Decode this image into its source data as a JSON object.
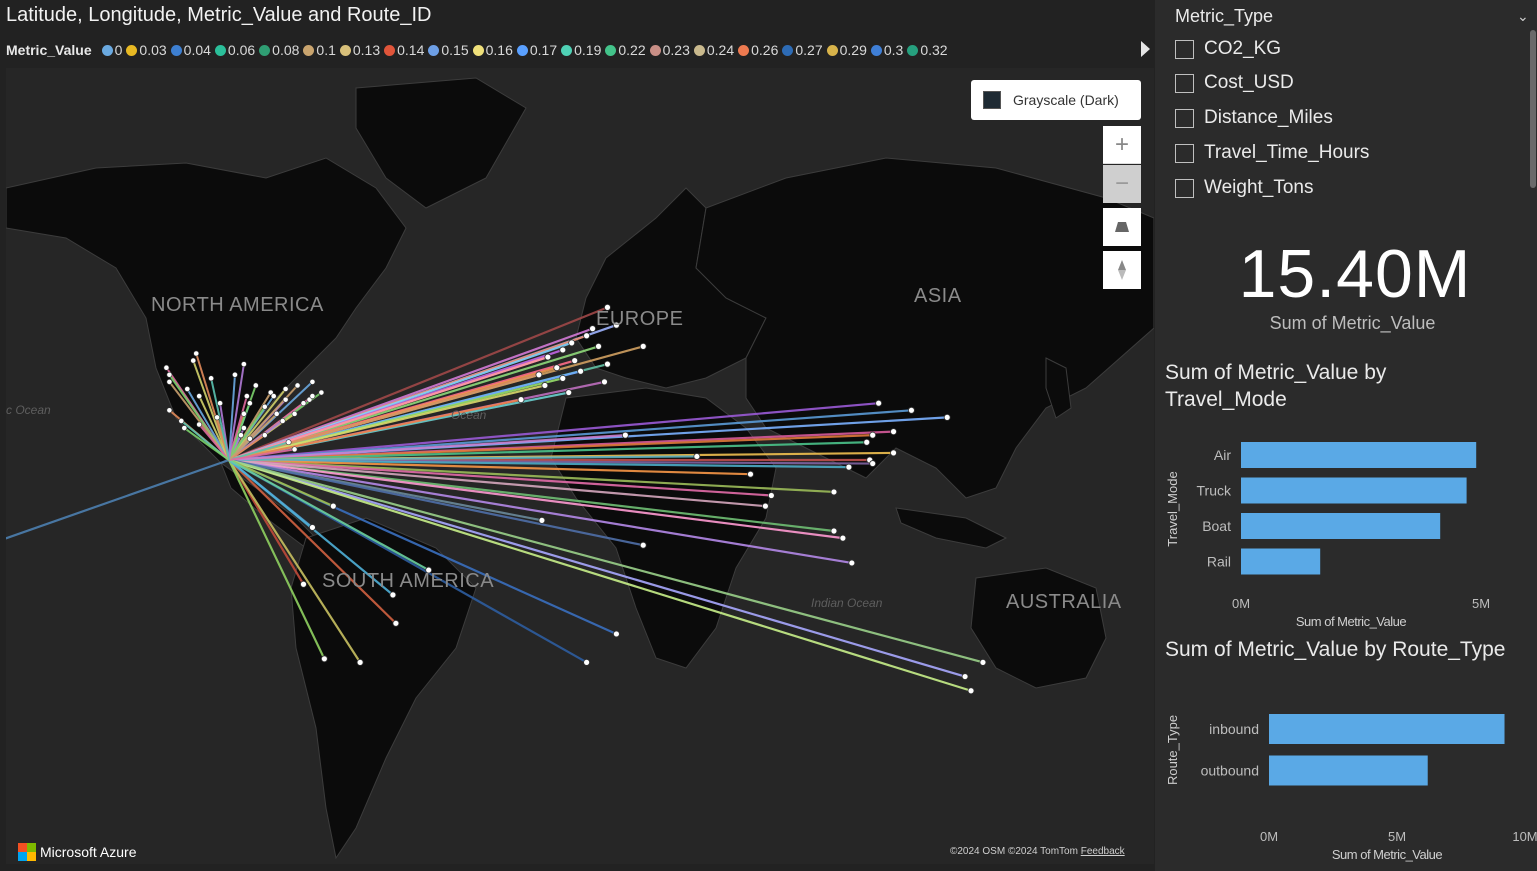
{
  "map": {
    "title": "Latitude, Longitude, Metric_Value and Route_ID",
    "legend_title": "Metric_Value",
    "legend_items": [
      {
        "label": "0",
        "color": "#6aa9e0"
      },
      {
        "label": "0.03",
        "color": "#e8b923"
      },
      {
        "label": "0.04",
        "color": "#3d7fd1"
      },
      {
        "label": "0.06",
        "color": "#2bbf9a"
      },
      {
        "label": "0.08",
        "color": "#2f9e73"
      },
      {
        "label": "0.1",
        "color": "#c9a46e"
      },
      {
        "label": "0.13",
        "color": "#d8c07a"
      },
      {
        "label": "0.14",
        "color": "#e0553a"
      },
      {
        "label": "0.15",
        "color": "#6d9fe6"
      },
      {
        "label": "0.16",
        "color": "#efe07a"
      },
      {
        "label": "0.17",
        "color": "#5aa0ff"
      },
      {
        "label": "0.19",
        "color": "#4fd1b5"
      },
      {
        "label": "0.22",
        "color": "#43c38a"
      },
      {
        "label": "0.23",
        "color": "#c98f86"
      },
      {
        "label": "0.24",
        "color": "#c9b98d"
      },
      {
        "label": "0.26",
        "color": "#ee7a50"
      },
      {
        "label": "0.27",
        "color": "#2d6bb5"
      },
      {
        "label": "0.29",
        "color": "#d8b34a"
      },
      {
        "label": "0.3",
        "color": "#3f7fd6"
      },
      {
        "label": "0.32",
        "color": "#26a07e"
      }
    ],
    "region_labels": {
      "north_america": "NORTH AMERICA",
      "europe": "EUROPE",
      "asia": "ASIA",
      "south_america": "SOUTH AMERICA",
      "australia": "AUSTRALIA"
    },
    "ocean_labels": {
      "pacific": "c Ocean",
      "atlantic": "Ocean",
      "indian": "Indian Ocean"
    },
    "style_button_label": "Grayscale (Dark)",
    "zoom_in_symbol": "+",
    "zoom_out_symbol": "−",
    "brand": "Microsoft Azure",
    "attribution": "©2024 OSM  ©2024 TomTom",
    "feedback_link": "Feedback",
    "route_hub": {
      "lat": 23,
      "lon": -102
    },
    "routes": [
      {
        "lat": 66,
        "lon": 25,
        "color": "#a04848"
      },
      {
        "lat": 61,
        "lon": 28,
        "color": "#9fb4ff"
      },
      {
        "lat": 60,
        "lon": 20,
        "color": "#d37ad6"
      },
      {
        "lat": 58,
        "lon": 18,
        "color": "#e88b6b"
      },
      {
        "lat": 56,
        "lon": 13,
        "color": "#7fd4ff"
      },
      {
        "lat": 55,
        "lon": 22,
        "color": "#8fd97a"
      },
      {
        "lat": 54,
        "lon": 10,
        "color": "#c266e6"
      },
      {
        "lat": 52,
        "lon": 5,
        "color": "#e0c04a"
      },
      {
        "lat": 51,
        "lon": 14,
        "color": "#ff6d8a"
      },
      {
        "lat": 50,
        "lon": 25,
        "color": "#62c2a5"
      },
      {
        "lat": 49,
        "lon": 8,
        "color": "#f09a50"
      },
      {
        "lat": 48,
        "lon": 16,
        "color": "#6fa8ff"
      },
      {
        "lat": 47,
        "lon": 2,
        "color": "#e05a8c"
      },
      {
        "lat": 46,
        "lon": 10,
        "color": "#98e06a"
      },
      {
        "lat": 45,
        "lon": 24,
        "color": "#bf6fbf"
      },
      {
        "lat": 44,
        "lon": 4,
        "color": "#d9d96b"
      },
      {
        "lat": 42,
        "lon": 12,
        "color": "#6ad0d0"
      },
      {
        "lat": 40,
        "lon": -4,
        "color": "#f07f4a"
      },
      {
        "lat": 52,
        "lon": 5,
        "color": "#ff8fb0"
      },
      {
        "lat": 55,
        "lon": 37,
        "color": "#d0a060"
      },
      {
        "lat": 39,
        "lon": 116,
        "color": "#9a5ad6"
      },
      {
        "lat": 37,
        "lon": 127,
        "color": "#5a9ad6"
      },
      {
        "lat": 35,
        "lon": 139,
        "color": "#7ab0ff"
      },
      {
        "lat": 31,
        "lon": 121,
        "color": "#d65a9a"
      },
      {
        "lat": 30,
        "lon": 114,
        "color": "#e07a3a"
      },
      {
        "lat": 28,
        "lon": 112,
        "color": "#4ac28a"
      },
      {
        "lat": 25,
        "lon": 121,
        "color": "#f0c050"
      },
      {
        "lat": 23,
        "lon": 113,
        "color": "#c0504d"
      },
      {
        "lat": 22,
        "lon": 114,
        "color": "#8064a2"
      },
      {
        "lat": 21,
        "lon": 106,
        "color": "#4bacc6"
      },
      {
        "lat": 19,
        "lon": 73,
        "color": "#f79646"
      },
      {
        "lat": 14,
        "lon": 101,
        "color": "#9bbb59"
      },
      {
        "lat": 13,
        "lon": 80,
        "color": "#e36ca8"
      },
      {
        "lat": 3,
        "lon": 101,
        "color": "#6fbf73"
      },
      {
        "lat": 1,
        "lon": 104,
        "color": "#ff9ad1"
      },
      {
        "lat": -6,
        "lon": 107,
        "color": "#b488e8"
      },
      {
        "lat": 10,
        "lon": 78,
        "color": "#d5a6bd"
      },
      {
        "lat": 24,
        "lon": 55,
        "color": "#5fb3c2"
      },
      {
        "lat": 30,
        "lon": 31,
        "color": "#c97fcf"
      },
      {
        "lat": 6,
        "lon": 3,
        "color": "#6a8a9a"
      },
      {
        "lat": -1,
        "lon": 37,
        "color": "#4f6fa8"
      },
      {
        "lat": -26,
        "lon": 28,
        "color": "#3a6fbf"
      },
      {
        "lat": -34,
        "lon": 18,
        "color": "#2d5da0"
      },
      {
        "lat": -38,
        "lon": 145,
        "color": "#a9a9ff"
      },
      {
        "lat": -42,
        "lon": 147,
        "color": "#c8f08a"
      },
      {
        "lat": -34,
        "lon": 151,
        "color": "#9ad08a"
      },
      {
        "lat": -12,
        "lon": -77,
        "color": "#c04a3a"
      },
      {
        "lat": -23,
        "lon": -46,
        "color": "#d06040"
      },
      {
        "lat": -34,
        "lon": -58,
        "color": "#c8c060"
      },
      {
        "lat": -33,
        "lon": -70,
        "color": "#8fd060"
      },
      {
        "lat": 4,
        "lon": -74,
        "color": "#58a0d0"
      },
      {
        "lat": 10,
        "lon": -67,
        "color": "#a0c050"
      },
      {
        "lat": -15,
        "lon": -47,
        "color": "#4fb0d8"
      },
      {
        "lat": -8,
        "lon": -35,
        "color": "#6cd0a0"
      },
      {
        "lat": 0,
        "lon": -180,
        "color": "#4d7fb0"
      }
    ],
    "na_points": [
      {
        "lat": 49,
        "lon": -123
      },
      {
        "lat": 47,
        "lon": -122
      },
      {
        "lat": 45,
        "lon": -122
      },
      {
        "lat": 43,
        "lon": -116
      },
      {
        "lat": 41,
        "lon": -112
      },
      {
        "lat": 39,
        "lon": -105
      },
      {
        "lat": 37,
        "lon": -122
      },
      {
        "lat": 34,
        "lon": -118
      },
      {
        "lat": 33,
        "lon": -112
      },
      {
        "lat": 32,
        "lon": -117
      },
      {
        "lat": 35,
        "lon": -106
      },
      {
        "lat": 30,
        "lon": -98
      },
      {
        "lat": 29,
        "lon": -95
      },
      {
        "lat": 32,
        "lon": -97
      },
      {
        "lat": 36,
        "lon": -97
      },
      {
        "lat": 39,
        "lon": -95
      },
      {
        "lat": 41,
        "lon": -96
      },
      {
        "lat": 44,
        "lon": -93
      },
      {
        "lat": 42,
        "lon": -88
      },
      {
        "lat": 41,
        "lon": -87
      },
      {
        "lat": 43,
        "lon": -83
      },
      {
        "lat": 40,
        "lon": -83
      },
      {
        "lat": 39,
        "lon": -77
      },
      {
        "lat": 40,
        "lon": -75
      },
      {
        "lat": 41,
        "lon": -74
      },
      {
        "lat": 42,
        "lon": -71
      },
      {
        "lat": 44,
        "lon": -79
      },
      {
        "lat": 45,
        "lon": -74
      },
      {
        "lat": 36,
        "lon": -80
      },
      {
        "lat": 34,
        "lon": -84
      },
      {
        "lat": 30,
        "lon": -90
      },
      {
        "lat": 28,
        "lon": -82
      },
      {
        "lat": 26,
        "lon": -80
      },
      {
        "lat": 38,
        "lon": -90
      },
      {
        "lat": 36,
        "lon": -86
      },
      {
        "lat": 47,
        "lon": -100
      },
      {
        "lat": 51,
        "lon": -114
      },
      {
        "lat": 50,
        "lon": -97
      },
      {
        "lat": 53,
        "lon": -113
      },
      {
        "lat": 46,
        "lon": -108
      }
    ]
  },
  "panel": {
    "slicer": {
      "header": "Metric_Type",
      "items": [
        "CO2_KG",
        "Cost_USD",
        "Distance_Miles",
        "Travel_Time_Hours",
        "Weight_Tons"
      ]
    },
    "kpi": {
      "value": "15.40M",
      "label": "Sum of Metric_Value"
    },
    "chart_travel_mode": {
      "title": "Sum of Metric_Value by Travel_Mode",
      "xlabel": "Sum of Metric_Value",
      "ylabel": "Travel_Mode",
      "tick_labels": [
        "0M",
        "5M"
      ],
      "bar_color": "#5aa9e6"
    },
    "chart_route_type": {
      "title": "Sum of Metric_Value by Route_Type",
      "xlabel": "Sum of Metric_Value",
      "ylabel": "Route_Type",
      "tick_labels": [
        "0M",
        "5M",
        "10M"
      ],
      "bar_color": "#5aa9e6"
    }
  },
  "chart_data": [
    {
      "type": "bar",
      "orientation": "horizontal",
      "title": "Sum of Metric_Value by Travel_Mode",
      "categories": [
        "Air",
        "Truck",
        "Boat",
        "Rail"
      ],
      "values": [
        4.9,
        4.7,
        4.15,
        1.65
      ],
      "xlabel": "Sum of Metric_Value",
      "ylabel": "Travel_Mode",
      "xlim": [
        0,
        5
      ],
      "ticks": [
        "0M",
        "5M"
      ],
      "units": "M",
      "grid": false
    },
    {
      "type": "bar",
      "orientation": "horizontal",
      "title": "Sum of Metric_Value by Route_Type",
      "categories": [
        "inbound",
        "outbound"
      ],
      "values": [
        9.2,
        6.2
      ],
      "xlabel": "Sum of Metric_Value",
      "ylabel": "Route_Type",
      "xlim": [
        0,
        10
      ],
      "ticks": [
        "0M",
        "5M",
        "10M"
      ],
      "units": "M",
      "grid": false
    }
  ]
}
